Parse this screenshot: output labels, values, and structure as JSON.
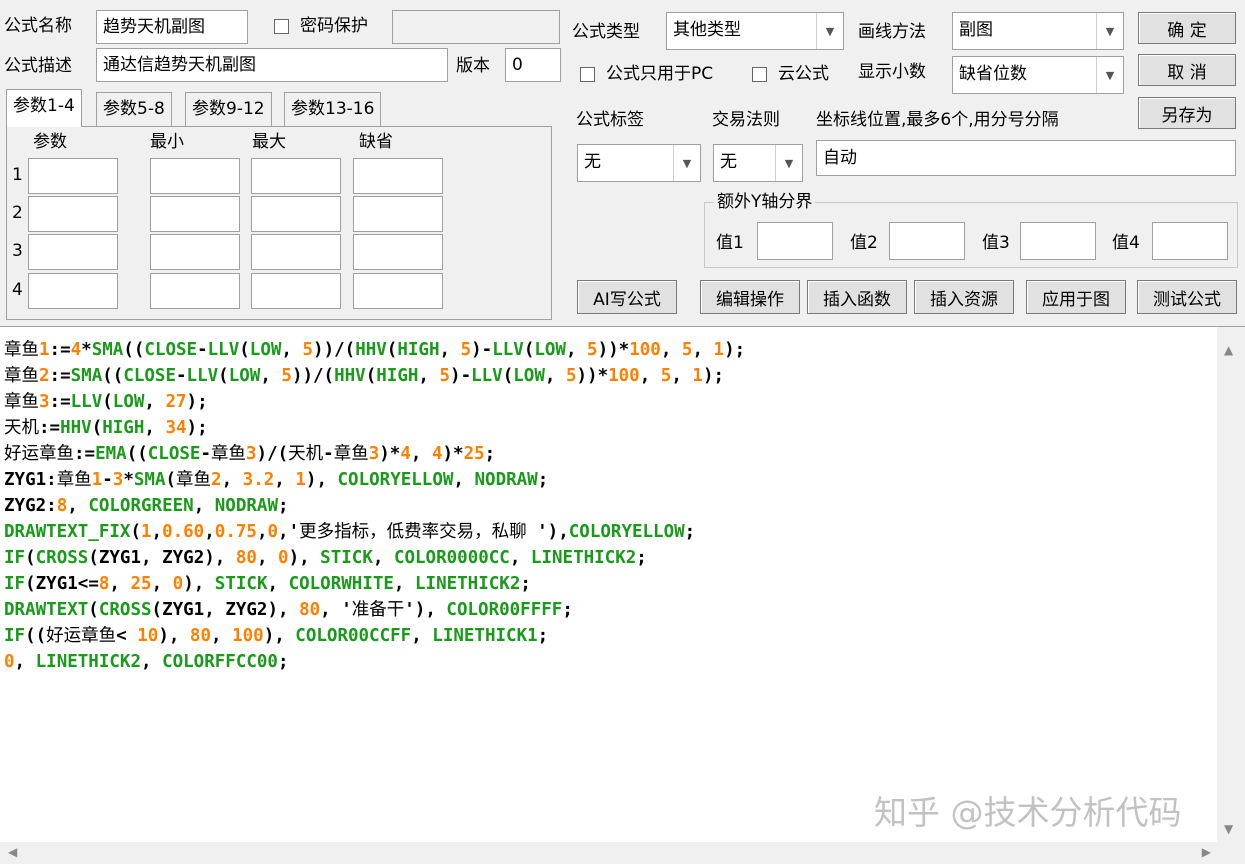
{
  "header": {
    "formula_name_label": "公式名称",
    "formula_name_value": "趋势天机副图",
    "password_label": "密码保护",
    "password_value": "",
    "desc_label": "公式描述",
    "desc_value": "通达信趋势天机副图",
    "version_label": "版本",
    "version_value": "0"
  },
  "tabs": [
    "参数1-4",
    "参数5-8",
    "参数9-12",
    "参数13-16"
  ],
  "params": {
    "columns": [
      "参数",
      "最小",
      "最大",
      "缺省"
    ],
    "rows": [
      "1",
      "2",
      "3",
      "4"
    ]
  },
  "options": {
    "type_label": "公式类型",
    "type_value": "其他类型",
    "draw_label": "画线方法",
    "draw_value": "副图",
    "pc_only_label": "公式只用于PC",
    "cloud_label": "云公式",
    "decimal_label": "显示小数",
    "decimal_value": "缺省位数",
    "tag_label": "公式标签",
    "tag_value": "无",
    "rule_label": "交易法则",
    "rule_value": "无",
    "axis_label": "坐标线位置,最多6个,用分号分隔",
    "axis_value": "自动",
    "ybound_label": "额外Y轴分界",
    "ybound_fields": [
      "值1",
      "值2",
      "值3",
      "值4"
    ]
  },
  "buttons": {
    "ok": "确 定",
    "cancel": "取 消",
    "save_as": "另存为",
    "ai": "AI写公式",
    "edit": "编辑操作",
    "insert_func": "插入函数",
    "insert_res": "插入资源",
    "apply": "应用于图",
    "test": "测试公式"
  },
  "code_lines": [
    "章鱼1:=4*SMA((CLOSE-LLV(LOW, 5))/(HHV(HIGH, 5)-LLV(LOW, 5))*100, 5, 1);",
    "章鱼2:=SMA((CLOSE-LLV(LOW, 5))/(HHV(HIGH, 5)-LLV(LOW, 5))*100, 5, 1);",
    "章鱼3:=LLV(LOW, 27);",
    "天机:=HHV(HIGH, 34);",
    "好运章鱼:=EMA((CLOSE-章鱼3)/(天机-章鱼3)*4, 4)*25;",
    "ZYG1:章鱼1-3*SMA(章鱼2, 3.2, 1), COLORYELLOW, NODRAW;",
    "ZYG2:8, COLORGREEN, NODRAW;",
    "DRAWTEXT_FIX(1,0.60,0.75,0,'更多指标，低费率交易，私聊 '),COLORYELLOW;",
    "IF(CROSS(ZYG1, ZYG2), 80, 0), STICK, COLOR0000CC, LINETHICK2;",
    "IF(ZYG1<=8, 25, 0), STICK, COLORWHITE, LINETHICK2;",
    "DRAWTEXT(CROSS(ZYG1, ZYG2), 80, '准备干'), COLOR00FFFF;",
    "IF((好运章鱼< 10), 80, 100), COLOR00CCFF, LINETHICK1;",
    "0, LINETHICK2, COLORFFCC00;"
  ],
  "watermark": "知乎 @技术分析代码",
  "colors": {
    "keyword": "#1a9a1a",
    "number": "#ff8000",
    "text": "#000000"
  }
}
